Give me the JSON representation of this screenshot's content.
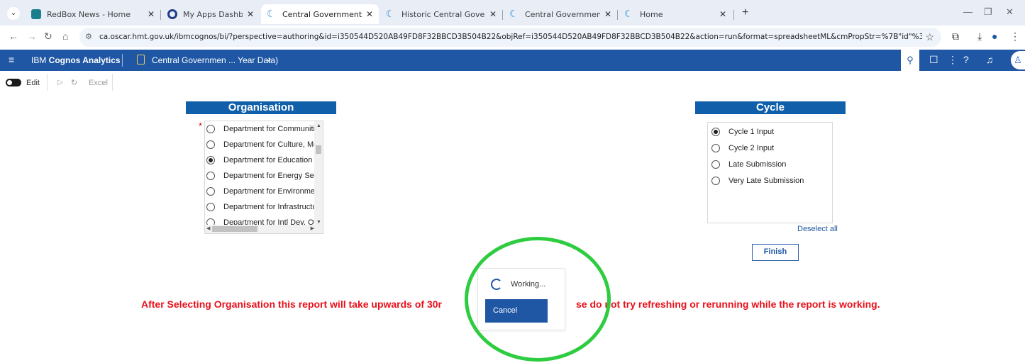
{
  "browser": {
    "tabs": [
      {
        "label": "RedBox News - Home"
      },
      {
        "label": "My Apps Dashboard | oscar"
      },
      {
        "label": "Central Government – Non CPIC"
      },
      {
        "label": "Historic Central Government Ac"
      },
      {
        "label": "Central Government CLS – CPIC"
      },
      {
        "label": "Home"
      }
    ],
    "url": "ca.oscar.hmt.gov.uk/ibmcognos/bi/?perspective=authoring&id=i350544D520AB49FD8F32BBCD3B504B22&objRef=i350544D520AB49FD8F32BBCD3B504B22&action=run&format=spreadsheetML&cmPropStr=%7B\"id\"%3A\"i350544D520AB49FD8F32BBCD3B504B2..."
  },
  "appbar": {
    "brand_prefix": "IBM ",
    "brand_bold": "Cognos Analytics",
    "report_title": "Central Governmen ... Year Data)"
  },
  "toolbar": {
    "edit_label": "Edit",
    "excel_label": "Excel"
  },
  "organisation": {
    "header": "Organisation",
    "required_marker": "*",
    "options": [
      {
        "label": "Department for Communities",
        "selected": false
      },
      {
        "label": "Department for Culture, Media",
        "selected": false
      },
      {
        "label": "Department for Education",
        "selected": true
      },
      {
        "label": "Department for Energy Securi",
        "selected": false
      },
      {
        "label": "Department for Environment F",
        "selected": false
      },
      {
        "label": "Department for Infrastructure",
        "selected": false
      },
      {
        "label": "Department for Intl Dev, Over",
        "selected": false
      }
    ]
  },
  "cycle": {
    "header": "Cycle",
    "options": [
      {
        "label": "Cycle 1 Input",
        "selected": true
      },
      {
        "label": "Cycle 2 Input",
        "selected": false
      },
      {
        "label": "Late Submission",
        "selected": false
      },
      {
        "label": "Very Late Submission",
        "selected": false
      }
    ],
    "deselect_label": "Deselect all",
    "finish_label": "Finish"
  },
  "warning": {
    "text_before": "After Selecting Organisation this report will take upwards of 30r",
    "text_after": "se do not try refreshing or rerunning while the report is working."
  },
  "working_dialog": {
    "status": "Working...",
    "cancel_label": "Cancel"
  },
  "colors": {
    "appbar": "#1f57a4",
    "header": "#0f5fab",
    "warning": "#e8101a",
    "annotation": "#2ecc40"
  }
}
